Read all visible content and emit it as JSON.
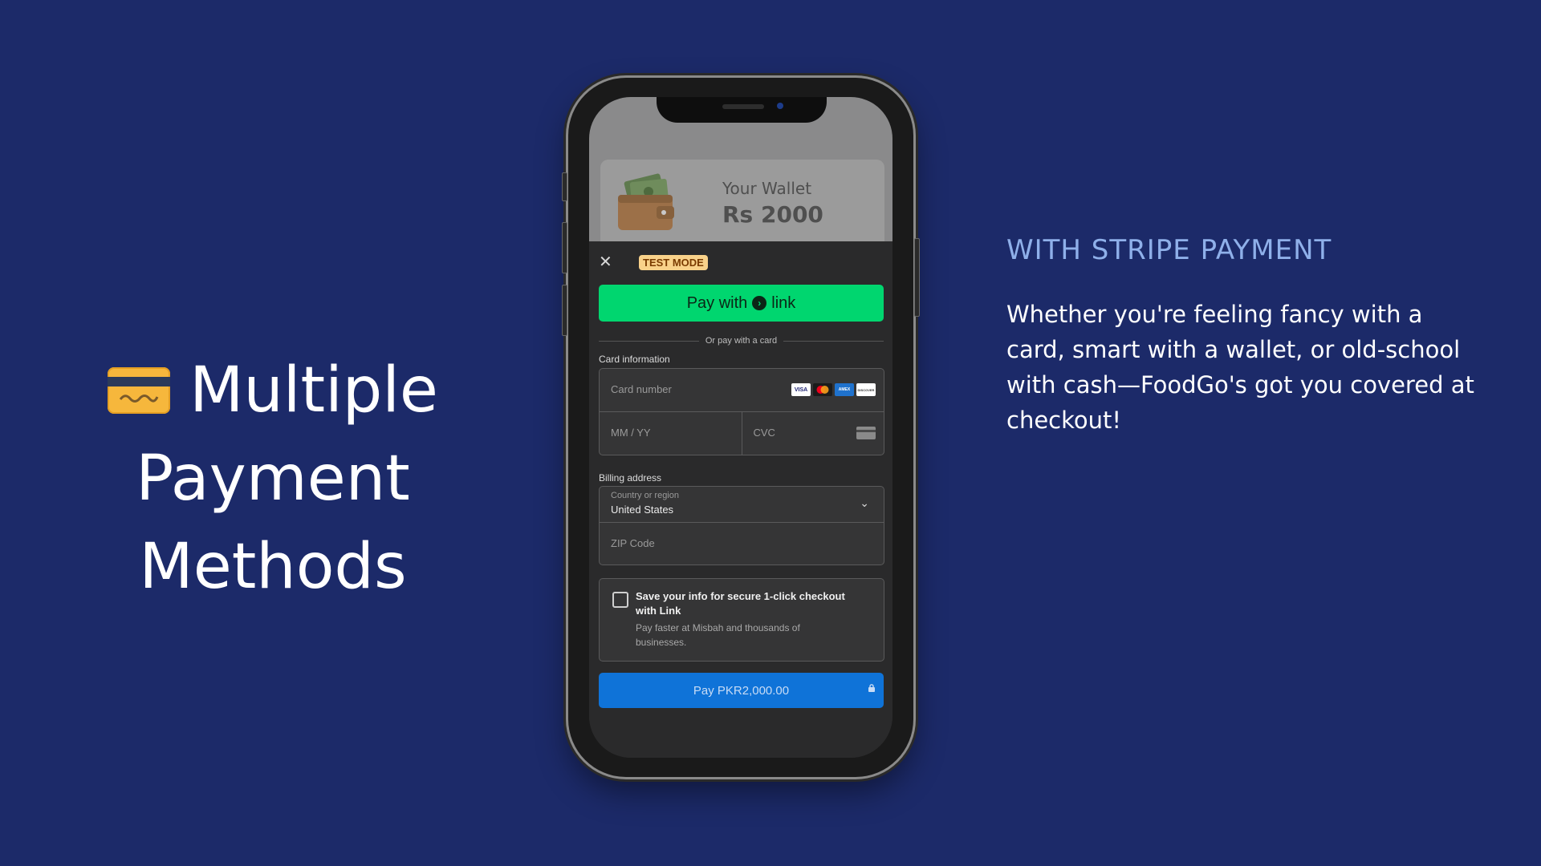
{
  "heading": {
    "line1": "Multiple",
    "line2": "Payment Methods",
    "icon": "credit-card-emoji"
  },
  "right": {
    "title": "WITH STRIPE PAYMENT",
    "body": "Whether you're feeling fancy with a card, smart with a wallet, or old-school with cash—FoodGo's got you covered at checkout!"
  },
  "wallet": {
    "title": "Wallet",
    "label": "Your Wallet",
    "amount": "Rs 2000"
  },
  "sheet": {
    "test_mode": "TEST MODE",
    "link_button": {
      "prefix": "Pay with",
      "brand": "link"
    },
    "divider": "Or pay with a card",
    "card_section_label": "Card information",
    "card_number_placeholder": "Card number",
    "expiry_placeholder": "MM / YY",
    "cvc_placeholder": "CVC",
    "card_brands": [
      "VISA",
      "MC",
      "AMEX",
      "DISCOVER"
    ],
    "billing_label": "Billing address",
    "country_label": "Country or region",
    "country_value": "United States",
    "zip_placeholder": "ZIP Code",
    "save_title": "Save your info for secure 1-click checkout with Link",
    "save_subtitle": "Pay faster at Misbah and thousands of businesses.",
    "pay_button": "Pay PKR2,000.00"
  },
  "colors": {
    "background": "#1c2a69",
    "link_green": "#00d66f",
    "pay_blue": "#0f73d8",
    "accent_title": "#8fb0ea"
  }
}
